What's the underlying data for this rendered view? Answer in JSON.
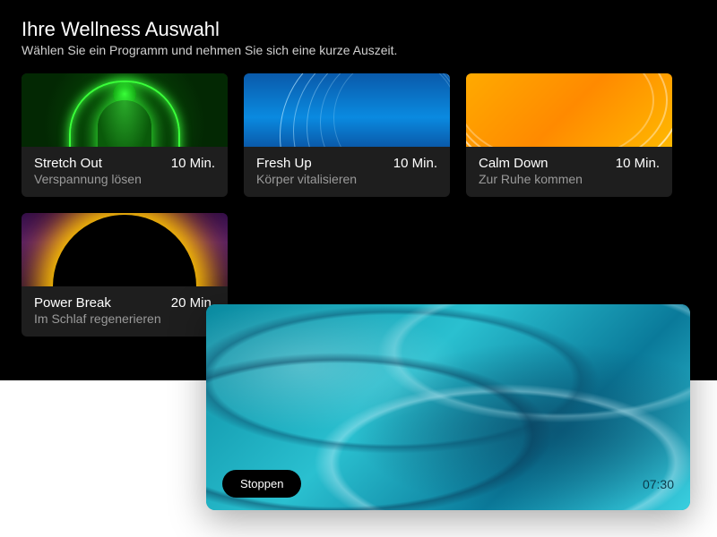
{
  "header": {
    "title": "Ihre Wellness Auswahl",
    "subtitle": "Wählen Sie ein Programm und nehmen Sie sich eine kurze Auszeit."
  },
  "programs": [
    {
      "title": "Stretch Out",
      "duration": "10 Min.",
      "desc": "Verspannung lösen",
      "theme": "green"
    },
    {
      "title": "Fresh Up",
      "duration": "10 Min.",
      "desc": "Körper vitalisieren",
      "theme": "blue"
    },
    {
      "title": "Calm Down",
      "duration": "10 Min.",
      "desc": "Zur Ruhe kommen",
      "theme": "orange"
    },
    {
      "title": "Power Break",
      "duration": "20 Min.",
      "desc": "Im Schlaf regenerieren",
      "theme": "eclipse"
    }
  ],
  "player": {
    "stop_label": "Stoppen",
    "timestamp": "07:30"
  }
}
